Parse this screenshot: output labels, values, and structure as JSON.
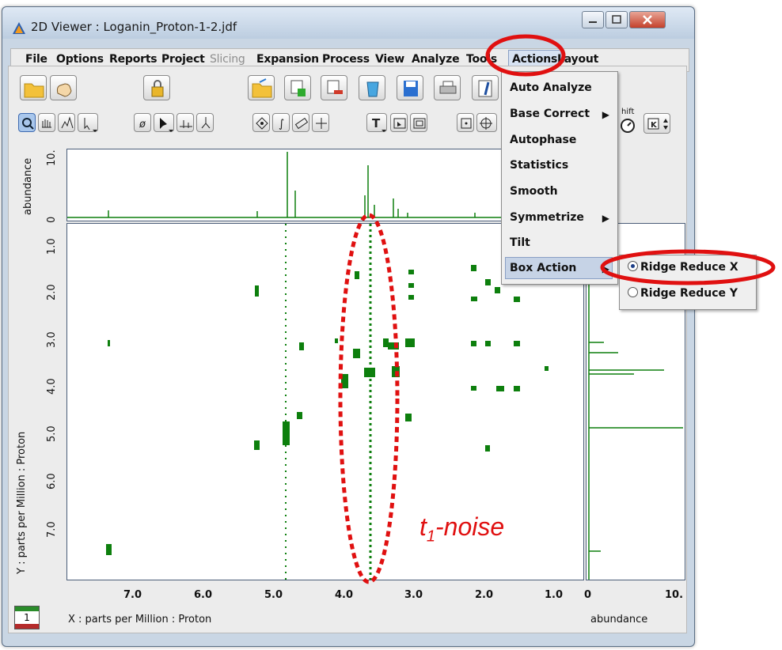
{
  "window": {
    "title": "2D Viewer : Loganin_Proton-1-2.jdf"
  },
  "menubar": {
    "items": [
      {
        "label": "File",
        "disabled": false
      },
      {
        "label": "Options",
        "disabled": false
      },
      {
        "label": "Reports",
        "disabled": false
      },
      {
        "label": "Project",
        "disabled": false
      },
      {
        "label": "Slicing",
        "disabled": true
      },
      {
        "label": "Expansion",
        "disabled": false
      },
      {
        "label": "Process",
        "disabled": false
      },
      {
        "label": "View",
        "disabled": false
      },
      {
        "label": "Analyze",
        "disabled": false
      },
      {
        "label": "Tools",
        "disabled": false
      },
      {
        "label": "Actions",
        "disabled": false
      },
      {
        "label": "Layout",
        "disabled": false
      }
    ]
  },
  "actions_menu": {
    "items": [
      {
        "label": "Auto Analyze",
        "submenu": false
      },
      {
        "label": "Base Correct",
        "submenu": true
      },
      {
        "label": "Autophase",
        "submenu": false
      },
      {
        "label": "Statistics",
        "submenu": false
      },
      {
        "label": "Smooth",
        "submenu": false
      },
      {
        "label": "Symmetrize",
        "submenu": true
      },
      {
        "label": "Tilt",
        "submenu": false
      },
      {
        "label": "Box Action",
        "submenu": true
      }
    ]
  },
  "box_action_submenu": {
    "items": [
      {
        "label": "Ridge Reduce X",
        "selected": true
      },
      {
        "label": "Ridge Reduce Y",
        "selected": false
      }
    ]
  },
  "toolbar": {
    "partial_label": "hift"
  },
  "top_trace": {
    "ylabel": "abundance",
    "ytick_top": "10.",
    "ytick_bottom": "0"
  },
  "right_trace": {
    "xlabel": "abundance",
    "xtick_left": "0",
    "xtick_right": "10."
  },
  "plot": {
    "xlabel": "X : parts per Million : Proton",
    "ylabel": "Y : parts per Million : Proton",
    "xticks": [
      "7.0",
      "6.0",
      "5.0",
      "4.0",
      "3.0",
      "2.0",
      "1.0"
    ],
    "yticks": [
      "1.0",
      "2.0",
      "3.0",
      "4.0",
      "5.0",
      "6.0",
      "7.0"
    ]
  },
  "page_indicator": "1",
  "annotation": {
    "t": "t",
    "sub": "1",
    "rest": "-noise"
  },
  "colors": {
    "peak": "#0d7f0d",
    "highlight": "#e01010"
  }
}
